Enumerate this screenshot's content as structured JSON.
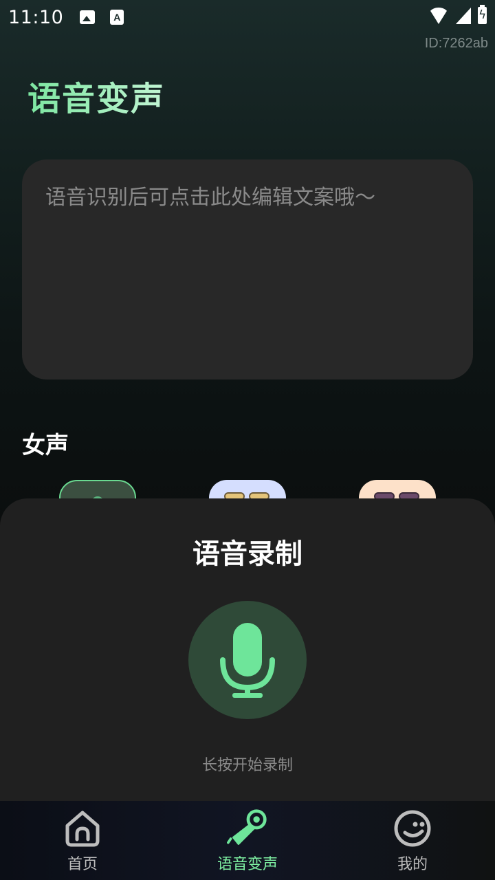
{
  "status_bar": {
    "time": "11:10"
  },
  "header": {
    "user_id": "ID:7262ab",
    "title": "语音变声"
  },
  "editor": {
    "placeholder": "语音识别后可点击此处编辑文案哦～"
  },
  "voice_section": {
    "title": "女声"
  },
  "record_sheet": {
    "title": "语音录制",
    "hint": "长按开始录制"
  },
  "bottom_nav": {
    "items": [
      {
        "label": "首页",
        "icon": "home-icon"
      },
      {
        "label": "语音变声",
        "icon": "voice-change-icon",
        "active": true
      },
      {
        "label": "我的",
        "icon": "smile-icon"
      }
    ]
  },
  "colors": {
    "accent": "#6ee59a",
    "sheet_bg": "#202020",
    "mic_bg": "#2f4a38"
  }
}
